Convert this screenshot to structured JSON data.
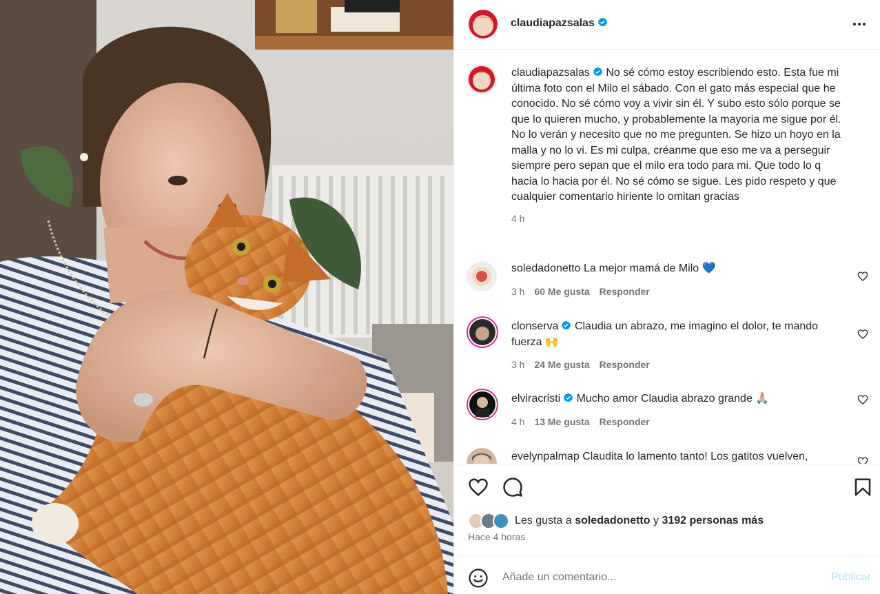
{
  "post": {
    "author": "claudiapazsalas",
    "caption": "No sé cómo estoy escribiendo esto. Esta fue mi última foto con el Milo el sábado. Con el gato más especial que he conocido. No sé cómo voy a vivir sin él. Y subo esto sólo porque se que lo quieren mucho, y probablemente la mayoria me sigue por él. No lo verán y necesito que no me pregunten. Se hizo un hoyo en la malla y no lo vi. Es mi culpa, créanme que eso me va a perseguir siempre pero sepan que el milo era todo para mi. Que todo lo q hacia lo hacia por él. No sé cómo se sigue. Les pido respeto y que cualquier comentario hiriente lo omitan gracias",
    "caption_time": "4 h"
  },
  "comments": [
    {
      "user": "soledadonetto",
      "text": "La mejor mamá de Milo 💙",
      "time": "3 h",
      "likes": "60 Me gusta",
      "reply": "Responder",
      "verified": false
    },
    {
      "user": "clonserva",
      "text": "Claudia un abrazo, me imagino el dolor, te mando fuerza 🙌",
      "time": "3 h",
      "likes": "24 Me gusta",
      "reply": "Responder",
      "verified": true
    },
    {
      "user": "elviracristi",
      "text": "Mucho amor Claudia abrazo grande 🙏🏼",
      "time": "4 h",
      "likes": "13 Me gusta",
      "reply": "Responder",
      "verified": true
    },
    {
      "user": "evelynpalmap",
      "text": "Claudita lo lamento tanto! Los gatitos vuelven,",
      "verified": false
    }
  ],
  "likes": {
    "prefix": "Les gusta a",
    "user": "soledadonetto",
    "joiner": "y",
    "others": "3192 personas más"
  },
  "time_ago": "Hace 4 horas",
  "composer": {
    "placeholder": "Añade un comentario...",
    "publish_label": "Publicar"
  },
  "colors": {
    "verified": "#0095f6",
    "muted": "#737373",
    "publish_disabled": "#b2dffc",
    "separator": "#efefef"
  },
  "icons": [
    "verified-badge-icon",
    "more-options-icon",
    "heart-icon",
    "comment-icon",
    "bookmark-icon",
    "emoji-icon"
  ]
}
